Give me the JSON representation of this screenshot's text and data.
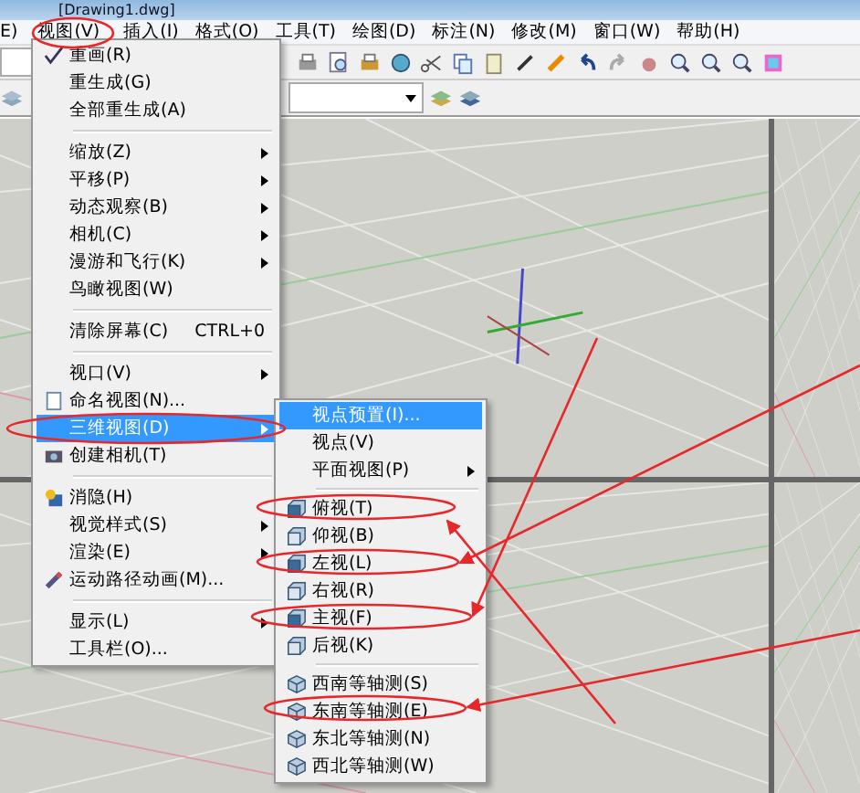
{
  "window": {
    "title": "[Drawing1.dwg]"
  },
  "menubar": [
    {
      "label": "E)"
    },
    {
      "label": "视图(V)"
    },
    {
      "label": "插入(I)"
    },
    {
      "label": "格式(O)"
    },
    {
      "label": "工具(T)"
    },
    {
      "label": "绘图(D)"
    },
    {
      "label": "标注(N)"
    },
    {
      "label": "修改(M)"
    },
    {
      "label": "窗口(W)"
    },
    {
      "label": "帮助(H)"
    }
  ],
  "view_menu": {
    "items": [
      {
        "kind": "item",
        "label": "重画(R)",
        "selected": false
      },
      {
        "kind": "item",
        "label": "重生成(G)",
        "selected": false
      },
      {
        "kind": "item",
        "label": "全部重生成(A)",
        "selected": false
      },
      {
        "kind": "separator"
      },
      {
        "kind": "submenu",
        "label": "缩放(Z)",
        "selected": false
      },
      {
        "kind": "submenu",
        "label": "平移(P)",
        "selected": false
      },
      {
        "kind": "submenu",
        "label": "动态观察(B)",
        "selected": false
      },
      {
        "kind": "submenu",
        "label": "相机(C)",
        "selected": false
      },
      {
        "kind": "submenu",
        "label": "漫游和飞行(K)",
        "selected": false
      },
      {
        "kind": "item",
        "label": "鸟瞰视图(W)",
        "selected": false
      },
      {
        "kind": "separator"
      },
      {
        "kind": "item",
        "label": "清除屏幕(C)",
        "shortcut": "CTRL+0",
        "selected": false
      },
      {
        "kind": "separator"
      },
      {
        "kind": "submenu",
        "label": "视口(V)",
        "selected": false
      },
      {
        "kind": "item",
        "label": "命名视图(N)...",
        "selected": false
      },
      {
        "kind": "submenu",
        "label": "三维视图(D)",
        "selected": true
      },
      {
        "kind": "item",
        "label": "创建相机(T)",
        "selected": false
      },
      {
        "kind": "separator"
      },
      {
        "kind": "item",
        "label": "消隐(H)",
        "selected": false
      },
      {
        "kind": "submenu",
        "label": "视觉样式(S)",
        "selected": false
      },
      {
        "kind": "submenu",
        "label": "渲染(E)",
        "selected": false
      },
      {
        "kind": "item",
        "label": "运动路径动画(M)...",
        "selected": false
      },
      {
        "kind": "separator"
      },
      {
        "kind": "submenu",
        "label": "显示(L)",
        "selected": false
      },
      {
        "kind": "item",
        "label": "工具栏(O)...",
        "selected": false
      }
    ]
  },
  "view_3d_submenu": {
    "items": [
      {
        "kind": "item",
        "label": "视点预置(I)...",
        "selected": true
      },
      {
        "kind": "item",
        "label": "视点(V)",
        "selected": false
      },
      {
        "kind": "submenu",
        "label": "平面视图(P)",
        "selected": false
      },
      {
        "kind": "separator"
      },
      {
        "kind": "item",
        "label": "俯视(T)",
        "selected": false
      },
      {
        "kind": "item",
        "label": "仰视(B)",
        "selected": false
      },
      {
        "kind": "item",
        "label": "左视(L)",
        "selected": false
      },
      {
        "kind": "item",
        "label": "右视(R)",
        "selected": false
      },
      {
        "kind": "item",
        "label": "主视(F)",
        "selected": false
      },
      {
        "kind": "item",
        "label": "后视(K)",
        "selected": false
      },
      {
        "kind": "separator"
      },
      {
        "kind": "item",
        "label": "西南等轴测(S)",
        "selected": false
      },
      {
        "kind": "item",
        "label": "东南等轴测(E)",
        "selected": false
      },
      {
        "kind": "item",
        "label": "东北等轴测(N)",
        "selected": false
      },
      {
        "kind": "item",
        "label": "西北等轴测(W)",
        "selected": false
      }
    ]
  }
}
